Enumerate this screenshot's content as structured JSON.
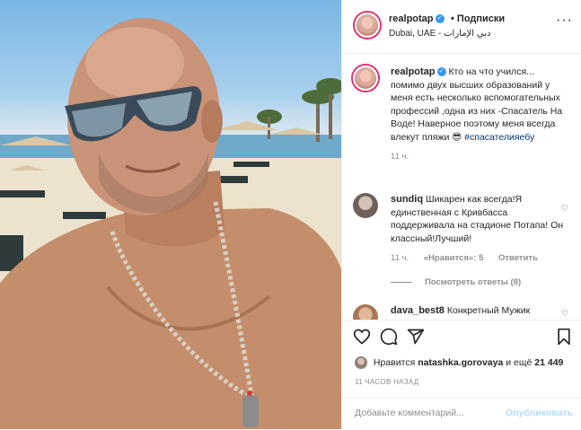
{
  "post": {
    "username": "realpotap",
    "follow_label": "• Подписки",
    "location": "Dubai, UAE - دبي الإمارات"
  },
  "caption": {
    "username": "realpotap",
    "text": "Кто на что учился... помимо двух высших образований у меня есть несколько вспомогательных профессий ,одна из них -Спасатель На Воде! Наверное поэтому меня всегда влекут пляжи 😎",
    "hashtag": "#спасателияебу",
    "time": "11 ч."
  },
  "comments": [
    {
      "username": "sundiq",
      "text": "Шикарен как всегда!Я единственная с Кривбасса поддерживала на стадионе Потапа! Он классный!Лучший!",
      "time": "11 ч.",
      "likes": "«Нравится»: 5",
      "reply": "Ответить",
      "replies": "Посмотреть ответы (8)"
    },
    {
      "username": "dava_best8",
      "text": "Конкретный Мужик"
    }
  ],
  "likes": {
    "prefix": "Нравится",
    "user": "natashka.gorovaya",
    "suffix": "и ещё",
    "count": "21 449"
  },
  "time_ago": "11 ЧАСОВ НАЗАД",
  "comment_input": {
    "placeholder": "Добавьте комментарий..."
  },
  "publish_label": "Опубликовать",
  "colors": {
    "link": "#00376b",
    "muted": "#8e8e8e",
    "verified": "#3897f0",
    "publish_disabled": "#b3dbff"
  }
}
